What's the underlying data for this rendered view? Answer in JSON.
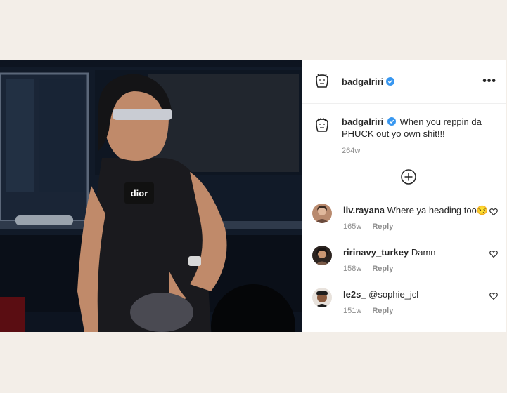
{
  "post": {
    "photo_tag": "dior",
    "author": {
      "username": "badgalriri"
    },
    "caption": {
      "username": "badgalriri",
      "text": "When you reppin da PHUCK out yo own shit!!!",
      "time": "264w"
    },
    "more_label": "•••",
    "comments": [
      {
        "username": "liv.rayana",
        "text": "Where ya heading too😏",
        "time": "165w",
        "reply": "Reply"
      },
      {
        "username": "ririnavy_turkey",
        "text": "Damn",
        "time": "158w",
        "reply": "Reply"
      },
      {
        "username": "le2s_",
        "text": "@sophie_jcl",
        "time": "151w",
        "reply": "Reply"
      }
    ]
  },
  "colors": {
    "verified": "#3897f0",
    "text": "#262626",
    "muted": "#8e8e8e",
    "background": "#f3eee8"
  },
  "icons": [
    "verified-badge-icon",
    "more-options-icon",
    "add-comment-icon",
    "heart-icon"
  ]
}
